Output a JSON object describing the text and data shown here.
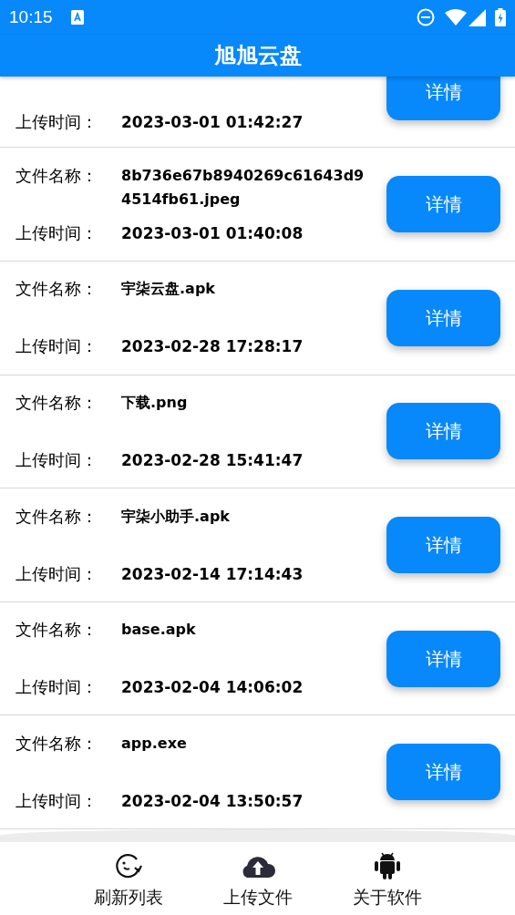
{
  "status_bar": {
    "time": "10:15"
  },
  "app_bar": {
    "title": "旭旭云盘"
  },
  "files": [
    {
      "time_label": "上传时间：",
      "time": "2023-03-01 01:42:27",
      "button": "详情"
    },
    {
      "name_label": "文件名称：",
      "name": "8b736e67b8940269c61643d94514fb61.jpeg",
      "time_label": "上传时间：",
      "time": "2023-03-01 01:40:08",
      "button": "详情"
    },
    {
      "name_label": "文件名称：",
      "name": "宇柒云盘.apk",
      "time_label": "上传时间：",
      "time": "2023-02-28 17:28:17",
      "button": "详情"
    },
    {
      "name_label": "文件名称：",
      "name": "下载.png",
      "time_label": "上传时间：",
      "time": "2023-02-28 15:41:47",
      "button": "详情"
    },
    {
      "name_label": "文件名称：",
      "name": "宇柒小助手.apk",
      "time_label": "上传时间：",
      "time": "2023-02-14 17:14:43",
      "button": "详情"
    },
    {
      "name_label": "文件名称：",
      "name": "base.apk",
      "time_label": "上传时间：",
      "time": "2023-02-04 14:06:02",
      "button": "详情"
    },
    {
      "name_label": "文件名称：",
      "name": "app.exe",
      "time_label": "上传时间：",
      "time": "2023-02-04 13:50:57",
      "button": "详情"
    }
  ],
  "bottom_nav": [
    {
      "kind": "refresh",
      "label": "刷新列表"
    },
    {
      "kind": "upload",
      "label": "上传文件"
    },
    {
      "kind": "about",
      "label": "关于软件"
    }
  ]
}
